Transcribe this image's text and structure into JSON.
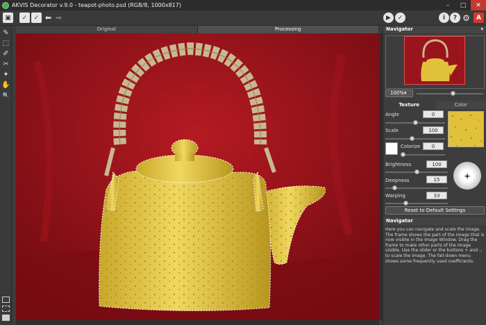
{
  "window": {
    "title": "AKVIS Decorator v.9.0 - teapot-photo.psd (RGB/8, 1000x817)",
    "minimize": "–",
    "maximize": "□",
    "close": "✕"
  },
  "toolbar": {
    "left_buttons": [
      {
        "name": "open-image-icon",
        "glyph": "▣"
      },
      {
        "name": "load-preset-icon",
        "glyph": "✓"
      },
      {
        "name": "save-preset-icon",
        "glyph": "✓"
      },
      {
        "name": "undo-icon",
        "glyph": "⬅"
      },
      {
        "name": "redo-icon",
        "glyph": "➡"
      }
    ],
    "run_glyph": "▶",
    "apply_glyph": "✓",
    "info_glyph": "i",
    "help_glyph": "?",
    "settings_glyph": "⚙",
    "brand_glyph": "A"
  },
  "tools": [
    {
      "name": "eraser-tool-icon",
      "glyph": "✎"
    },
    {
      "name": "selection-tool-icon",
      "glyph": "⬚"
    },
    {
      "name": "brush-tool-icon",
      "glyph": "✐"
    },
    {
      "name": "lasso-tool-icon",
      "glyph": "✂"
    },
    {
      "name": "magic-brush-tool-icon",
      "glyph": "✦"
    },
    {
      "name": "hand-tool-icon",
      "glyph": "✋"
    },
    {
      "name": "zoom-tool-icon",
      "glyph": "🔍"
    }
  ],
  "tabs": {
    "original": "Original",
    "processing": "Processing"
  },
  "navigator": {
    "title": "Navigator",
    "caret": "▾",
    "zoom": "100%▾",
    "zoom_position": 0.55
  },
  "settings": {
    "tab_texture": "Texture",
    "tab_color": "Color",
    "angle_label": "Angle",
    "angle_value": "0",
    "angle_position": 0.5,
    "scale_label": "Scale",
    "scale_value": "100",
    "scale_position": 0.45,
    "colorize_label": "Colorize",
    "colorize_value": "0",
    "colorize_position": 0.05,
    "brightness_label": "Brightness",
    "brightness_value": "100",
    "brightness_position": 0.5,
    "deepness_label": "Deepness",
    "deepness_value": "15",
    "deepness_position": 0.15,
    "warping_label": "Warping",
    "warping_value": "33",
    "warping_position": 0.33,
    "light_glyph": "+",
    "reset_label": "Reset to Default Settings"
  },
  "help": {
    "title": "Navigator",
    "text": "Here you can navigate and scale the image. The frame shows the part of the image that is now visible in the Image Window. Drag the frame to make other parts of the image visible. Use the slider or the buttons + and -, to scale the image. The fall-down menu shows some frequently used coefficients."
  },
  "colors": {
    "background": "#8e1118",
    "teapot": "#e2c13a",
    "handle": "#c8b890",
    "panel": "#3d3d3d"
  }
}
